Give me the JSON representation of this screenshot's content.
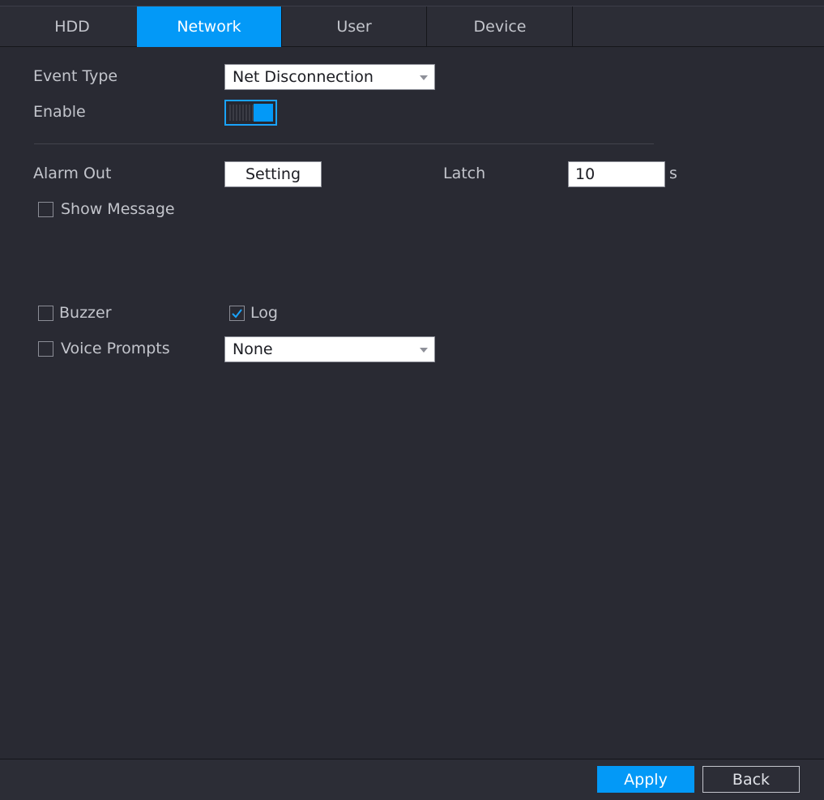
{
  "tabs": [
    {
      "label": "HDD",
      "active": false
    },
    {
      "label": "Network",
      "active": true
    },
    {
      "label": "User",
      "active": false
    },
    {
      "label": "Device",
      "active": false
    }
  ],
  "form": {
    "event_type_label": "Event Type",
    "event_type_value": "Net Disconnection",
    "enable_label": "Enable",
    "enable_on": true,
    "alarm_out_label": "Alarm Out",
    "setting_button": "Setting",
    "latch_label": "Latch",
    "latch_value": "10",
    "latch_unit": "s",
    "show_message_label": "Show Message",
    "show_message_checked": false,
    "buzzer_label": "Buzzer",
    "buzzer_checked": false,
    "log_label": "Log",
    "log_checked": true,
    "voice_prompts_label": "Voice Prompts",
    "voice_prompts_checked": false,
    "voice_prompts_value": "None"
  },
  "footer": {
    "apply_label": "Apply",
    "back_label": "Back"
  },
  "colors": {
    "accent": "#0399f7",
    "background": "#292a33"
  }
}
